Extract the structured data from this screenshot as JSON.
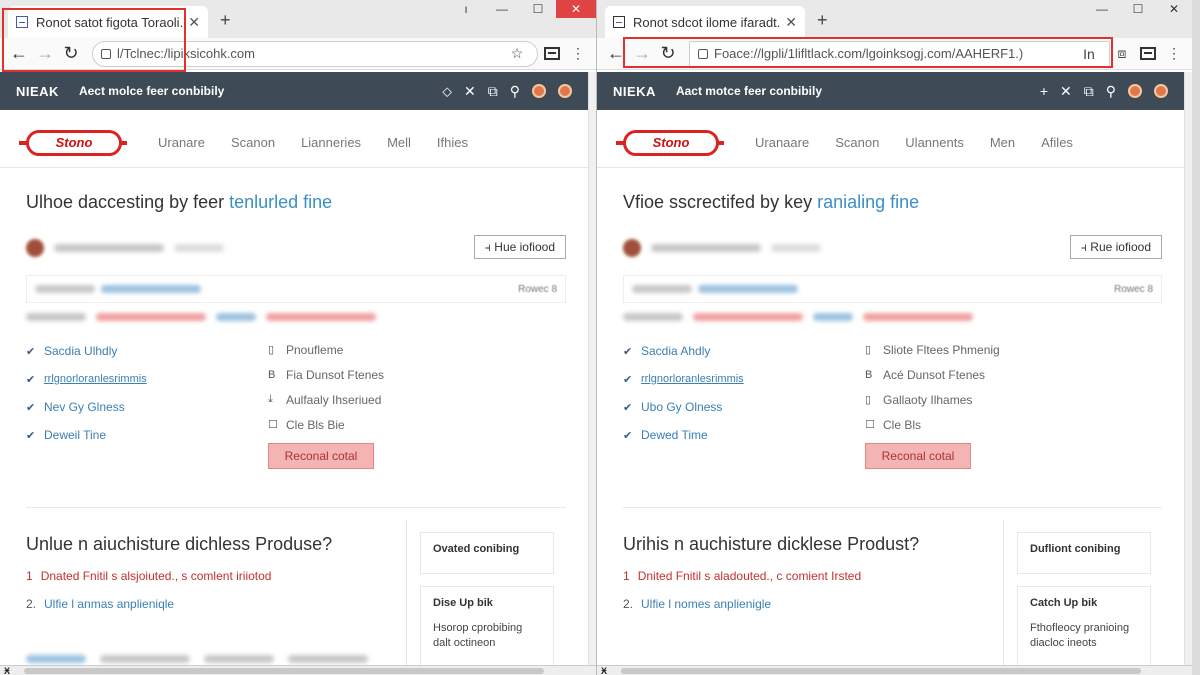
{
  "left": {
    "tab_title": "Ronot satot figota Toraoli.",
    "url": "l/Tclnec:/lipiksicohk.com",
    "brand": "NIEAK",
    "tagline": "Aect molce feer conbibily",
    "logo": "Stono",
    "nav": [
      "Uranare",
      "Scanon",
      "Lianneries",
      "Mell",
      "Ifhies"
    ],
    "headline_main": "Ulhoe daccesting by feer ",
    "headline_accent": "tenlurled fine",
    "follow_label": "Hue iofiood",
    "meta_right": "Rowec 8",
    "col1": [
      "Sacdia Ulhdly",
      "rrlgnorloranlesrimmis",
      "Nev Gy Glness",
      "Deweil Tine"
    ],
    "col2": [
      "Pnoufleme",
      "Fia Dunsot Ftenes",
      "Aulfaaly Ihseriued",
      "Cle Bls Bie"
    ],
    "reconal": "Reconal cotal",
    "question": "Unlue n aiuchisture dichless Produse?",
    "ol": [
      {
        "num": "1",
        "text": "Dnated Fnitil s alsjoiuted., s comlent iriiotod"
      },
      {
        "num": "2.",
        "text": "Ulfie l anmas anplieniqle"
      }
    ],
    "card1": "Ovated conibing",
    "card2_title": "Dise Up bik",
    "card2_desc": "Hsorop cprobibing dalt octineon"
  },
  "right": {
    "tab_title": "Ronot sdcot ilome ifaradt.",
    "url": "Foace://lgpli/1lifltlack.com/lgoinksogj.com/AAHERF1.)",
    "brand": "NIEKA",
    "tagline": "Aact motce feer conbibily",
    "logo": "Stono",
    "nav": [
      "Uranaare",
      "Scanon",
      "Ulannents",
      "Men",
      "Afiles"
    ],
    "headline_main": "Vfioe sscrectifed by key ",
    "headline_accent": "ranialing fine",
    "follow_label": "Rue iofiood",
    "meta_right": "Rowec 8",
    "col1": [
      "Sacdia Ahdly",
      "rrlgnorloranlesrimmis",
      "Ubo Gy Olness",
      "Dewed Time"
    ],
    "col2": [
      "Sliote Fltees Phmenig",
      "Acé Dunsot Ftenes",
      "Gallaoty Ilhames",
      "Cle Bls"
    ],
    "reconal": "Reconal cotal",
    "question": "Urihis n auchisture dicklese Produst?",
    "ol": [
      {
        "num": "1",
        "text": "Dnited Fnitil s aladouted., c comient Irsted"
      },
      {
        "num": "2.",
        "text": "Ulfie l nomes anplienigle"
      }
    ],
    "card1": "Dufliont conibing",
    "card2_title": "Catch Up bik",
    "card2_desc": "Fthofleocy pranioing diacloc ineots"
  },
  "colors": {
    "site_bar": "#3e4a55",
    "accent_blue": "#3a8fc5",
    "highlight_red": "#e03030",
    "logo_red": "#d22222"
  }
}
